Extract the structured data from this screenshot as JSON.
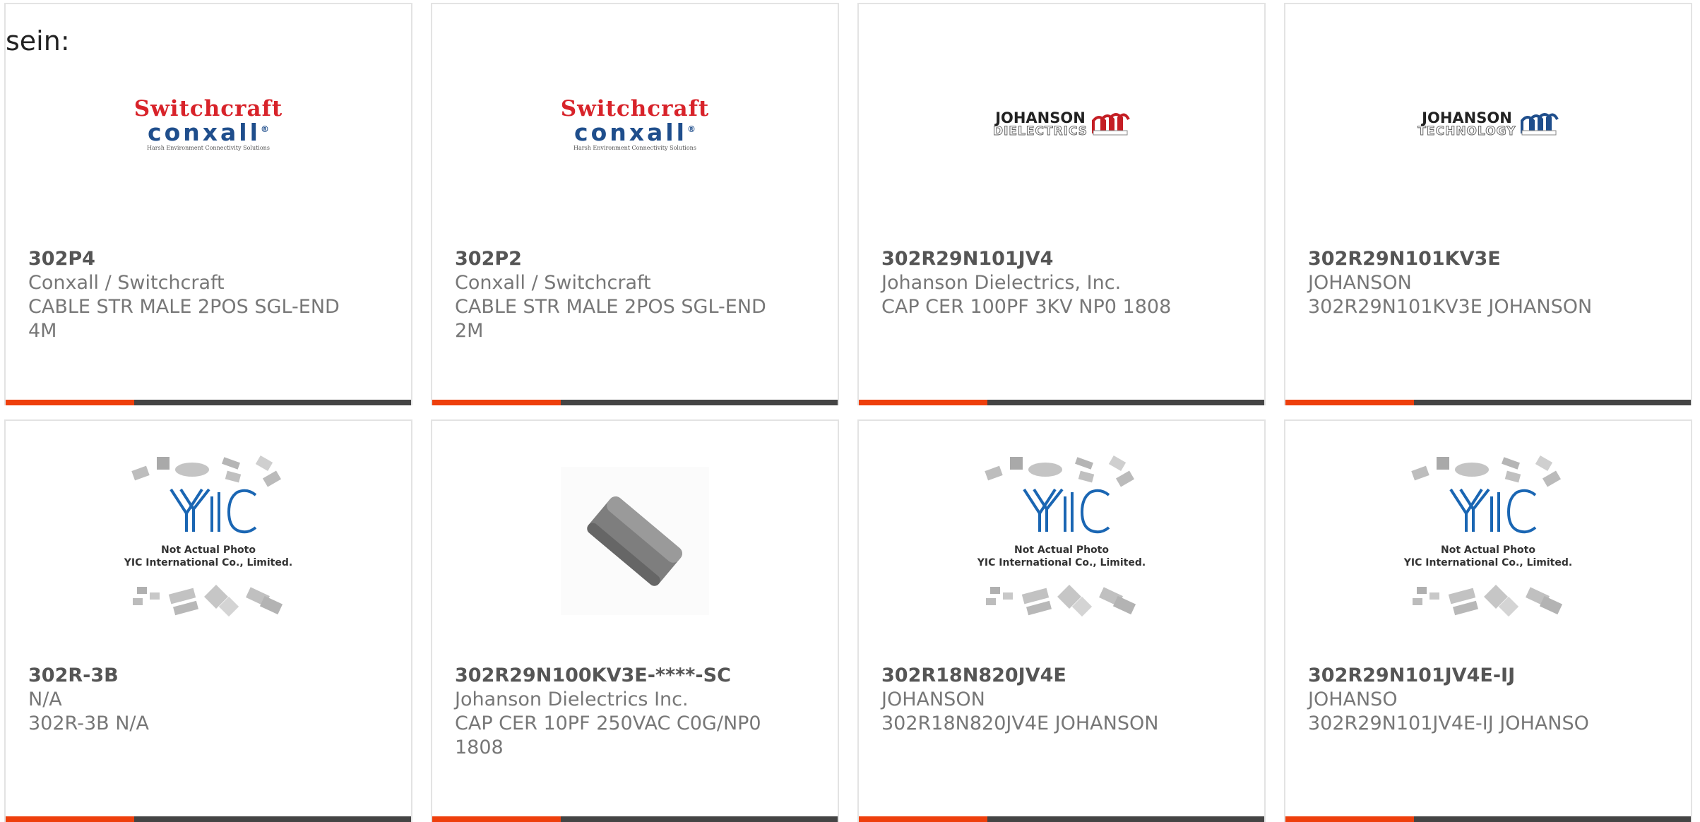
{
  "intro_text": "sein:",
  "products": [
    {
      "part_number": "302P4",
      "manufacturer": "Conxall / Switchcraft",
      "description": "CABLE STR MALE 2POS SGL-END 4M",
      "image": "switchcraft-conxall-logo",
      "logo": {
        "line1": "Switchcraft",
        "line2": "conxall",
        "tagline": "Harsh Environment Connectivity Solutions"
      }
    },
    {
      "part_number": "302P2",
      "manufacturer": "Conxall / Switchcraft",
      "description": "CABLE STR MALE 2POS SGL-END 2M",
      "image": "switchcraft-conxall-logo",
      "logo": {
        "line1": "Switchcraft",
        "line2": "conxall",
        "tagline": "Harsh Environment Connectivity Solutions"
      }
    },
    {
      "part_number": "302R29N101JV4",
      "manufacturer": "Johanson Dielectrics, Inc.",
      "description": "CAP CER 100PF 3KV NP0 1808",
      "image": "johanson-dielectrics-logo",
      "logo": {
        "line1": "JOHANSON",
        "line2": "DIELECTRICS"
      }
    },
    {
      "part_number": "302R29N101KV3E",
      "manufacturer": "JOHANSON",
      "description": "302R29N101KV3E JOHANSON",
      "image": "johanson-technology-logo",
      "logo": {
        "line1": "JOHANSON",
        "line2": "TECHNOLOGY"
      }
    },
    {
      "part_number": "302R-3B",
      "manufacturer": "N/A",
      "description": "302R-3B N/A",
      "image": "yic-placeholder",
      "placeholder": {
        "line1": "Not Actual Photo",
        "line2": "YIC International Co., Limited."
      }
    },
    {
      "part_number": "302R29N100KV3E-****-SC",
      "manufacturer": "Johanson Dielectrics Inc.",
      "description": "CAP CER 10PF 250VAC C0G/NP0 1808",
      "image": "ceramic-capacitor-photo"
    },
    {
      "part_number": "302R18N820JV4E",
      "manufacturer": "JOHANSON",
      "description": "302R18N820JV4E JOHANSON",
      "image": "yic-placeholder",
      "placeholder": {
        "line1": "Not Actual Photo",
        "line2": "YIC International Co., Limited."
      }
    },
    {
      "part_number": "302R29N101JV4E-IJ",
      "manufacturer": "JOHANSO",
      "description": "302R29N101JV4E-IJ JOHANSO",
      "image": "yic-placeholder",
      "placeholder": {
        "line1": "Not Actual Photo",
        "line2": "YIC International Co., Limited."
      }
    }
  ],
  "colors": {
    "accent": "#ee3f0c",
    "bar": "#444444",
    "border": "#e3e3e3",
    "text": "#777777",
    "part_number": "#555555"
  }
}
